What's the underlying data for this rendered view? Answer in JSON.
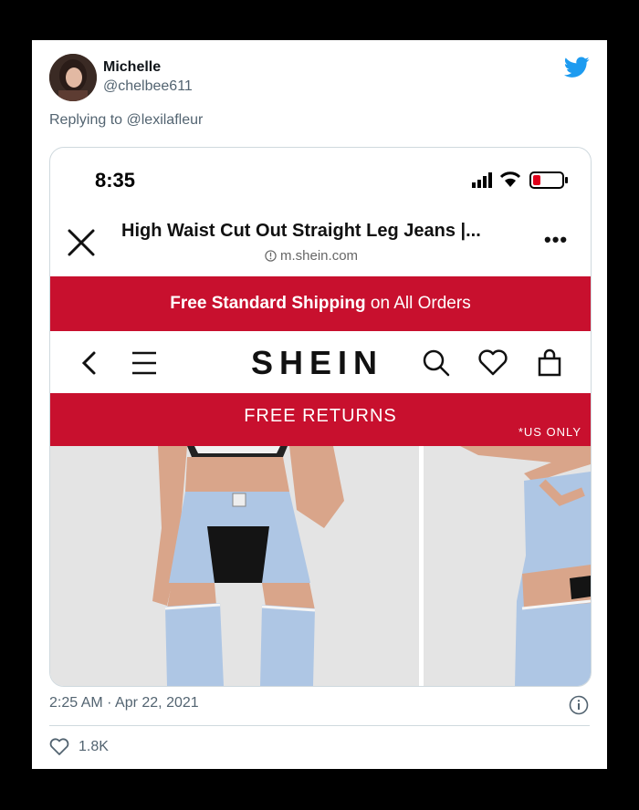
{
  "tweet": {
    "display_name": "Michelle",
    "handle": "@chelbee611",
    "replying_prefix": "Replying to",
    "replying_to": "@lexilafleur",
    "timestamp": "2:25 AM · Apr 22, 2021",
    "like_count": "1.8K"
  },
  "phone": {
    "time": "8:35",
    "page_title": "High Waist Cut Out Straight Leg Jeans |...",
    "page_url": "m.shein.com",
    "more": "•••"
  },
  "shein": {
    "shipping_bold": "Free Standard Shipping",
    "shipping_rest": " on All Orders",
    "brand": "SHEIN",
    "returns": "FREE RETURNS",
    "us_only": "*US ONLY"
  },
  "colors": {
    "twitter_blue": "#1d9bf0",
    "shein_red": "#c8102e",
    "secondary_text": "#536471"
  },
  "icons": [
    "twitter-bird-icon",
    "close-icon",
    "info-icon",
    "back-chevron-icon",
    "menu-icon",
    "search-icon",
    "heart-icon",
    "bag-icon",
    "like-icon"
  ]
}
